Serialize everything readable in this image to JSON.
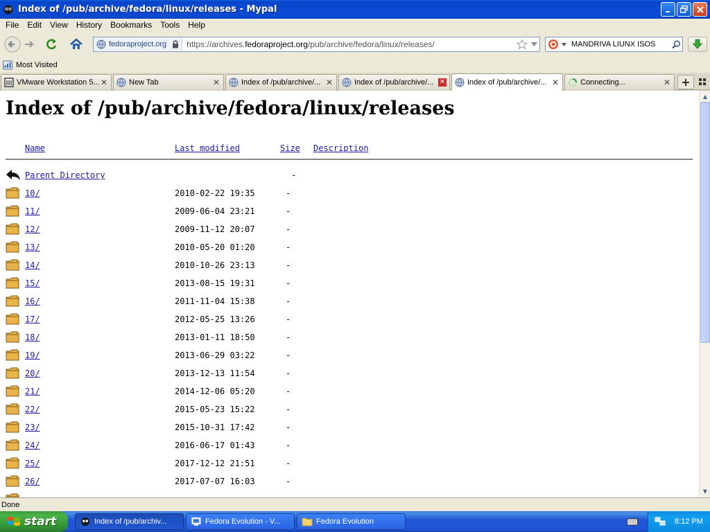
{
  "window": {
    "title": "Index of /pub/archive/fedora/linux/releases - Mypal"
  },
  "menu": [
    "File",
    "Edit",
    "View",
    "History",
    "Bookmarks",
    "Tools",
    "Help"
  ],
  "navbar": {
    "identity": "fedoraproject.org",
    "url_prefix": "https://archives.",
    "url_domain": "fedoraproject.org",
    "url_path": "/pub/archive/fedora/linux/releases/",
    "search_value": "MANDRIVA LIUNX ISOS"
  },
  "bookmarks": {
    "most_visited": "Most Visited"
  },
  "tabs": [
    {
      "label": "VMware Workstation 5...",
      "close": "✕"
    },
    {
      "label": "New Tab",
      "close": "✕"
    },
    {
      "label": "Index of /pub/archive/...",
      "close": "✕"
    },
    {
      "label": "Index of /pub/archive/...",
      "close": "✕"
    },
    {
      "label": "Index of /pub/archive/...",
      "close": "✕"
    },
    {
      "label": "Connecting...",
      "close": "✕"
    }
  ],
  "page": {
    "title": "Index of /pub/archive/fedora/linux/releases",
    "columns": {
      "name": "Name",
      "modified": "Last modified",
      "size": "Size",
      "description": "Description"
    },
    "parent": {
      "name": "Parent Directory",
      "size": "-"
    },
    "rows": [
      {
        "name": "10/",
        "date": "2010-02-22 19:35",
        "size": "-"
      },
      {
        "name": "11/",
        "date": "2009-06-04 23:21",
        "size": "-"
      },
      {
        "name": "12/",
        "date": "2009-11-12 20:07",
        "size": "-"
      },
      {
        "name": "13/",
        "date": "2010-05-20 01:20",
        "size": "-"
      },
      {
        "name": "14/",
        "date": "2010-10-26 23:13",
        "size": "-"
      },
      {
        "name": "15/",
        "date": "2013-08-15 19:31",
        "size": "-"
      },
      {
        "name": "16/",
        "date": "2011-11-04 15:38",
        "size": "-"
      },
      {
        "name": "17/",
        "date": "2012-05-25 13:26",
        "size": "-"
      },
      {
        "name": "18/",
        "date": "2013-01-11 18:50",
        "size": "-"
      },
      {
        "name": "19/",
        "date": "2013-06-29 03:22",
        "size": "-"
      },
      {
        "name": "20/",
        "date": "2013-12-13 11:54",
        "size": "-"
      },
      {
        "name": "21/",
        "date": "2014-12-06 05:20",
        "size": "-"
      },
      {
        "name": "22/",
        "date": "2015-05-23 15:22",
        "size": "-"
      },
      {
        "name": "23/",
        "date": "2015-10-31 17:42",
        "size": "-"
      },
      {
        "name": "24/",
        "date": "2016-06-17 01:43",
        "size": "-"
      },
      {
        "name": "25/",
        "date": "2017-12-12 21:51",
        "size": "-"
      },
      {
        "name": "26/",
        "date": "2017-07-07 16:03",
        "size": "-"
      }
    ]
  },
  "status": {
    "text": "Done"
  },
  "taskbar": {
    "start": "start",
    "tasks": [
      {
        "label": "Index of /pub/archiv..."
      },
      {
        "label": "Fedora Evolution - V..."
      },
      {
        "label": "Fedora Evolution"
      }
    ],
    "clock": "8:12 PM"
  }
}
